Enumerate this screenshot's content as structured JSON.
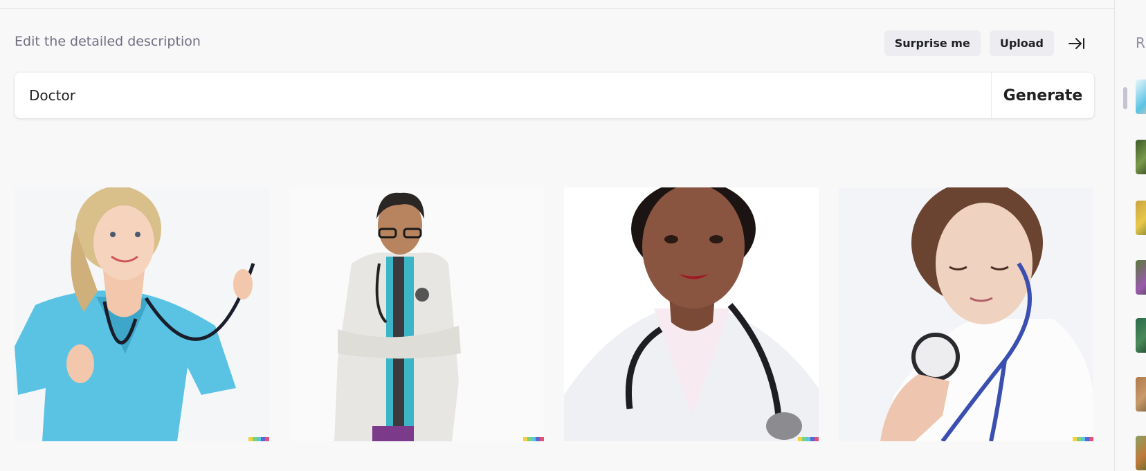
{
  "header": {
    "description_label": "Edit the detailed description",
    "surprise_label": "Surprise me",
    "upload_label": "Upload"
  },
  "prompt": {
    "value": "Doctor",
    "generate_label": "Generate"
  },
  "results": [
    {
      "subject": "smiling blonde woman in light blue scrubs holding a stethoscope"
    },
    {
      "subject": "man with glasses in white lab coat, arms crossed, stethoscope around neck"
    },
    {
      "subject": "woman in white coat with stethoscope around neck"
    },
    {
      "subject": "woman in white coat looking down at blue stethoscope"
    }
  ],
  "sidebar": {
    "heading_initial": "R"
  },
  "colors": {
    "accent_strip": [
      "#f5d142",
      "#7ad27a",
      "#5ec6d8",
      "#5a67d8",
      "#e0527b"
    ]
  }
}
